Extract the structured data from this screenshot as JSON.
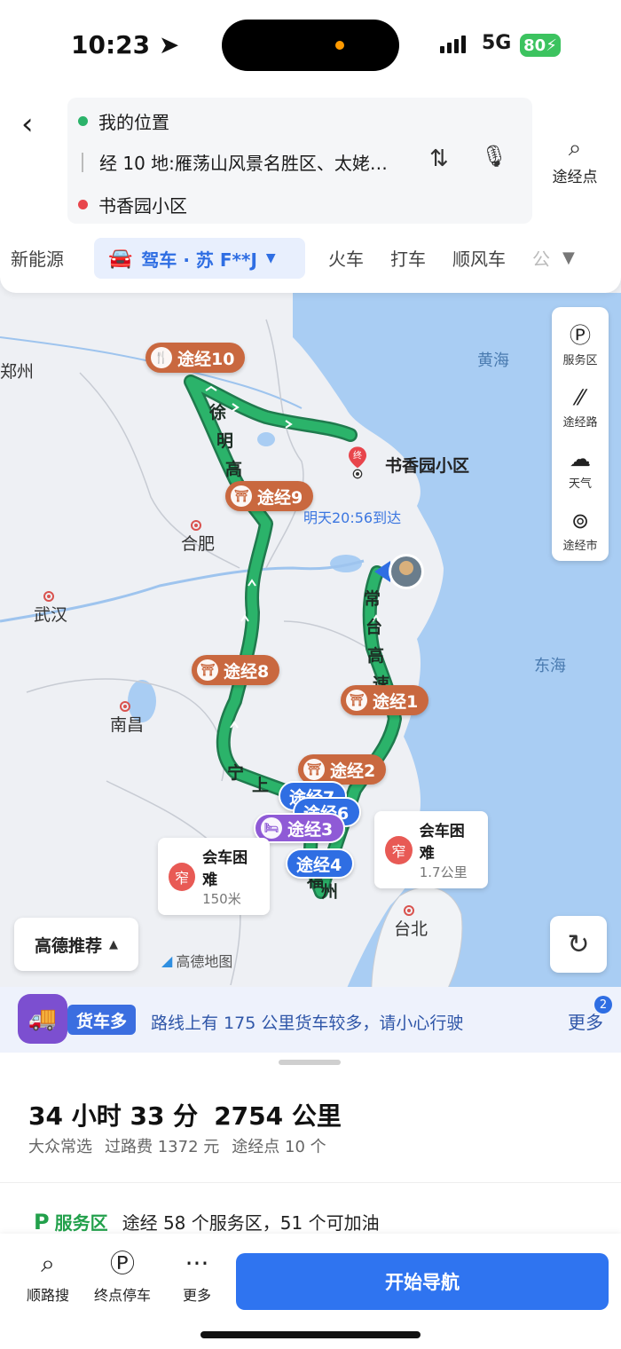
{
  "status_bar": {
    "time": "10:23",
    "network": "5G",
    "battery": "80"
  },
  "route": {
    "origin": "我的位置",
    "via": "经 10 地:雁荡山风景名胜区、太姥…",
    "destination": "书香园小区",
    "via_point_button": "途经点"
  },
  "tabs": {
    "left": "新能源",
    "active": "驾车 · 苏 F**J",
    "others": [
      "火车",
      "打车",
      "顺风车",
      "公"
    ]
  },
  "map": {
    "cities": [
      "郑州",
      "合肥",
      "武汉",
      "南昌",
      "台北"
    ],
    "seas": [
      "黄海",
      "东海"
    ],
    "road_labels": [
      "徐",
      "明",
      "高",
      "常",
      "台",
      "高",
      "速",
      "宁",
      "上",
      "福",
      "州"
    ],
    "destination_label": "书香园小区",
    "destination_badge": "终",
    "eta": "明天20:56到达",
    "waypoints": {
      "w10": "途经10",
      "w9": "途经9",
      "w8": "途经8",
      "w1": "途经1",
      "w2": "途经2",
      "w7": "途经7",
      "w6": "途经6",
      "w3": "途经3",
      "w4": "途经4"
    },
    "warnings": [
      {
        "badge": "窄",
        "title": "会车困难",
        "distance": "1.7公里"
      },
      {
        "badge": "窄",
        "title": "会车困难",
        "distance": "150米"
      }
    ],
    "side_tools": [
      "服务区",
      "途经路",
      "天气",
      "途经市"
    ],
    "recommend": "高德推荐",
    "logo": "高德地图",
    "route_color": "#2bb36a",
    "route_dark": "#1f7a4d"
  },
  "truck_notice": {
    "tag": "货车多",
    "message": "路线上有 175 公里货车较多，请小心行驶",
    "more": "更多",
    "badge": "2"
  },
  "summary": {
    "duration": "34 小时 33 分",
    "distance": "2754 公里",
    "details": [
      "大众常选",
      "过路费 1372 元",
      "途经点 10 个"
    ],
    "service_label": "服务区",
    "service_text": "途经 58 个服务区，51 个可加油"
  },
  "bottom_bar": {
    "items": [
      "顺路搜",
      "终点停车",
      "更多"
    ],
    "start": "开始导航"
  }
}
